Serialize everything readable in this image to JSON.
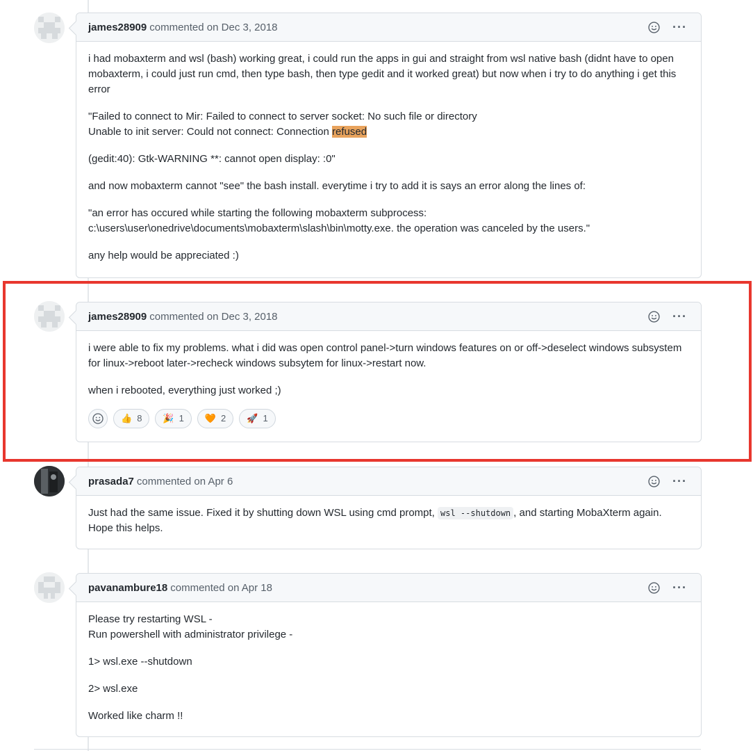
{
  "comments": [
    {
      "author": "james28909",
      "action": "commented on Dec 3, 2018",
      "paragraphs": [
        "i had mobaxterm and wsl (bash) working great, i could run the apps in gui and straight from wsl native bash (didnt have to open mobaxterm, i could just run cmd, then type bash, then type gedit and it worked great) but now when i try to do anything i get this error",
        "\"Failed to connect to Mir: Failed to connect to server socket: No such file or directory",
        "Unable to init server: Could not connect: Connection ",
        "refused",
        "(gedit:40): Gtk-WARNING **: cannot open display: :0\"",
        "and now mobaxterm cannot \"see\" the bash install. everytime i try to add it is says an error along the lines of:",
        "\"an error has occured while starting the following mobaxterm subprocess:",
        "c:\\users\\user\\onedrive\\documents\\mobaxterm\\slash\\bin\\motty.exe. the operation was canceled by the users.\"",
        "any help would be appreciated :)"
      ]
    },
    {
      "author": "james28909",
      "action": "commented on Dec 3, 2018",
      "paragraphs": [
        "i were able to fix my problems. what i did was open control panel->turn windows features on or off->deselect windows subsystem for linux->reboot later->recheck windows subsytem for linux->restart now.",
        "when i rebooted, everything just worked ;)"
      ],
      "reactions": [
        {
          "emoji": "👍",
          "icon": "thumbs-up-icon",
          "count": "8"
        },
        {
          "emoji": "🎉",
          "icon": "party-icon",
          "count": "1"
        },
        {
          "emoji": "🧡",
          "icon": "heart-icon",
          "count": "2"
        },
        {
          "emoji": "🚀",
          "icon": "rocket-icon",
          "count": "1"
        }
      ]
    },
    {
      "author": "prasada7",
      "action": "commented on Apr 6",
      "paragraphs": [
        "Just had the same issue. Fixed it by shutting down WSL using cmd prompt, ",
        "wsl --shutdown",
        ", and starting MobaXterm again. Hope this helps."
      ]
    },
    {
      "author": "pavanambure18",
      "action": "commented on Apr 18",
      "paragraphs": [
        "Please try restarting WSL -",
        "Run powershell with administrator privilege -",
        "1> wsl.exe --shutdown",
        "2> wsl.exe",
        "Worked like charm !!"
      ]
    }
  ],
  "colors": {
    "highlight_frame": "#e8372e",
    "text_highlight": "#e8a35d"
  }
}
